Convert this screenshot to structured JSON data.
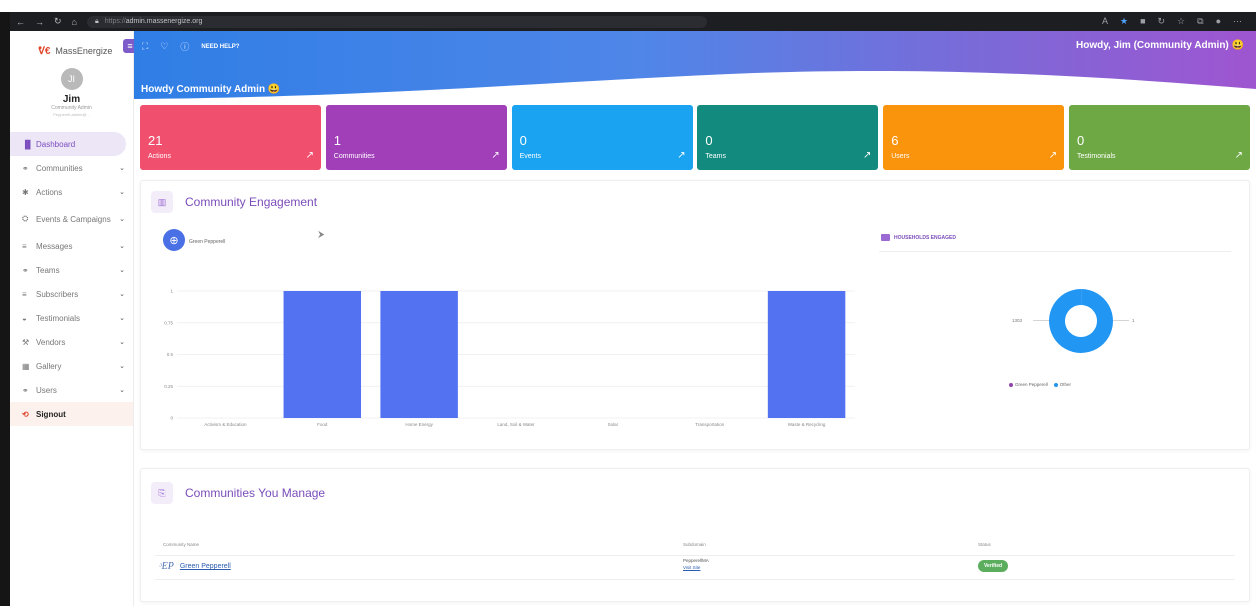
{
  "browser": {
    "url_scheme": "https://",
    "url_host": "admin.massenergize.org"
  },
  "brand": {
    "logo": "ᕓ€",
    "name": "MassEnergize"
  },
  "user": {
    "initial": "JI",
    "name": "Jim",
    "role": "Community Admin",
    "email": "Pepperell-admin@..."
  },
  "sidebar": {
    "items": [
      {
        "label": "Dashboard",
        "icon": "dashboard-icon",
        "glyph": "▐▌",
        "chevron": false,
        "active": true
      },
      {
        "label": "Communities",
        "icon": "communities-icon",
        "glyph": "⚭",
        "chevron": true
      },
      {
        "label": "Actions",
        "icon": "actions-icon",
        "glyph": "✱",
        "chevron": true
      },
      {
        "label": "Events & Campaigns",
        "icon": "events-icon",
        "glyph": "⛭",
        "chevron": true
      },
      {
        "label": "Messages",
        "icon": "messages-icon",
        "glyph": "≡",
        "chevron": true
      },
      {
        "label": "Teams",
        "icon": "teams-icon",
        "glyph": "⚭",
        "chevron": true
      },
      {
        "label": "Subscribers",
        "icon": "subscribers-icon",
        "glyph": "≡",
        "chevron": true
      },
      {
        "label": "Testimonials",
        "icon": "testimonials-icon",
        "glyph": "◒",
        "chevron": true
      },
      {
        "label": "Vendors",
        "icon": "vendors-icon",
        "glyph": "⚒",
        "chevron": true
      },
      {
        "label": "Gallery",
        "icon": "gallery-icon",
        "glyph": "▦",
        "chevron": true
      },
      {
        "label": "Users",
        "icon": "users-icon",
        "glyph": "⚭",
        "chevron": true
      },
      {
        "label": "Signout",
        "icon": "signout-icon",
        "glyph": "⟲",
        "chevron": false
      }
    ]
  },
  "header": {
    "help_label": "NEED HELP?",
    "howdy_right": "Howdy, Jim (Community Admin) 😃",
    "howdy_left": "Howdy Community Admin 😃"
  },
  "cards": [
    {
      "value": "21",
      "label": "Actions",
      "color": "#f0506e"
    },
    {
      "value": "1",
      "label": "Communities",
      "color": "#a03fb8"
    },
    {
      "value": "0",
      "label": "Events",
      "color": "#1aa3f0"
    },
    {
      "value": "0",
      "label": "Teams",
      "color": "#138a7e"
    },
    {
      "value": "6",
      "label": "Users",
      "color": "#f9940c"
    },
    {
      "value": "0",
      "label": "Testimonials",
      "color": "#6ea844"
    }
  ],
  "engagement": {
    "title": "Community Engagement",
    "series_name": "Green Pepperell",
    "households_title": "HOUSEHOLDS ENGAGED"
  },
  "chart_data": [
    {
      "type": "bar",
      "categories": [
        "Activism & Education",
        "Food",
        "Home Energy",
        "Land, Soil & Water",
        "Solar",
        "Transportation",
        "Waste & Recycling"
      ],
      "series": [
        {
          "name": "Green Pepperell",
          "values": [
            0,
            1,
            1,
            0,
            0,
            0,
            1
          ]
        }
      ],
      "yticks": [
        "0",
        "0.25",
        "0.5",
        "0.75",
        "1"
      ],
      "ylim": [
        0,
        1
      ],
      "color": "#5272f2",
      "grid": true
    },
    {
      "type": "pie",
      "labels": [
        "Green Pepperell",
        "Other"
      ],
      "values": [
        1,
        1303
      ],
      "value_labels": [
        "1",
        "1303"
      ],
      "colors": [
        "#8e44ad",
        "#2196f3"
      ],
      "legend": "bottom"
    }
  ],
  "communities": {
    "title": "Communities You Manage",
    "columns": [
      "Community Name",
      "Subdomain",
      "Status"
    ],
    "rows": [
      {
        "logo": "ᵓEP",
        "name": "Green Pepperell",
        "subdomain": "PepperellMA",
        "visit": "Visit Site",
        "status": "Verified"
      }
    ]
  }
}
